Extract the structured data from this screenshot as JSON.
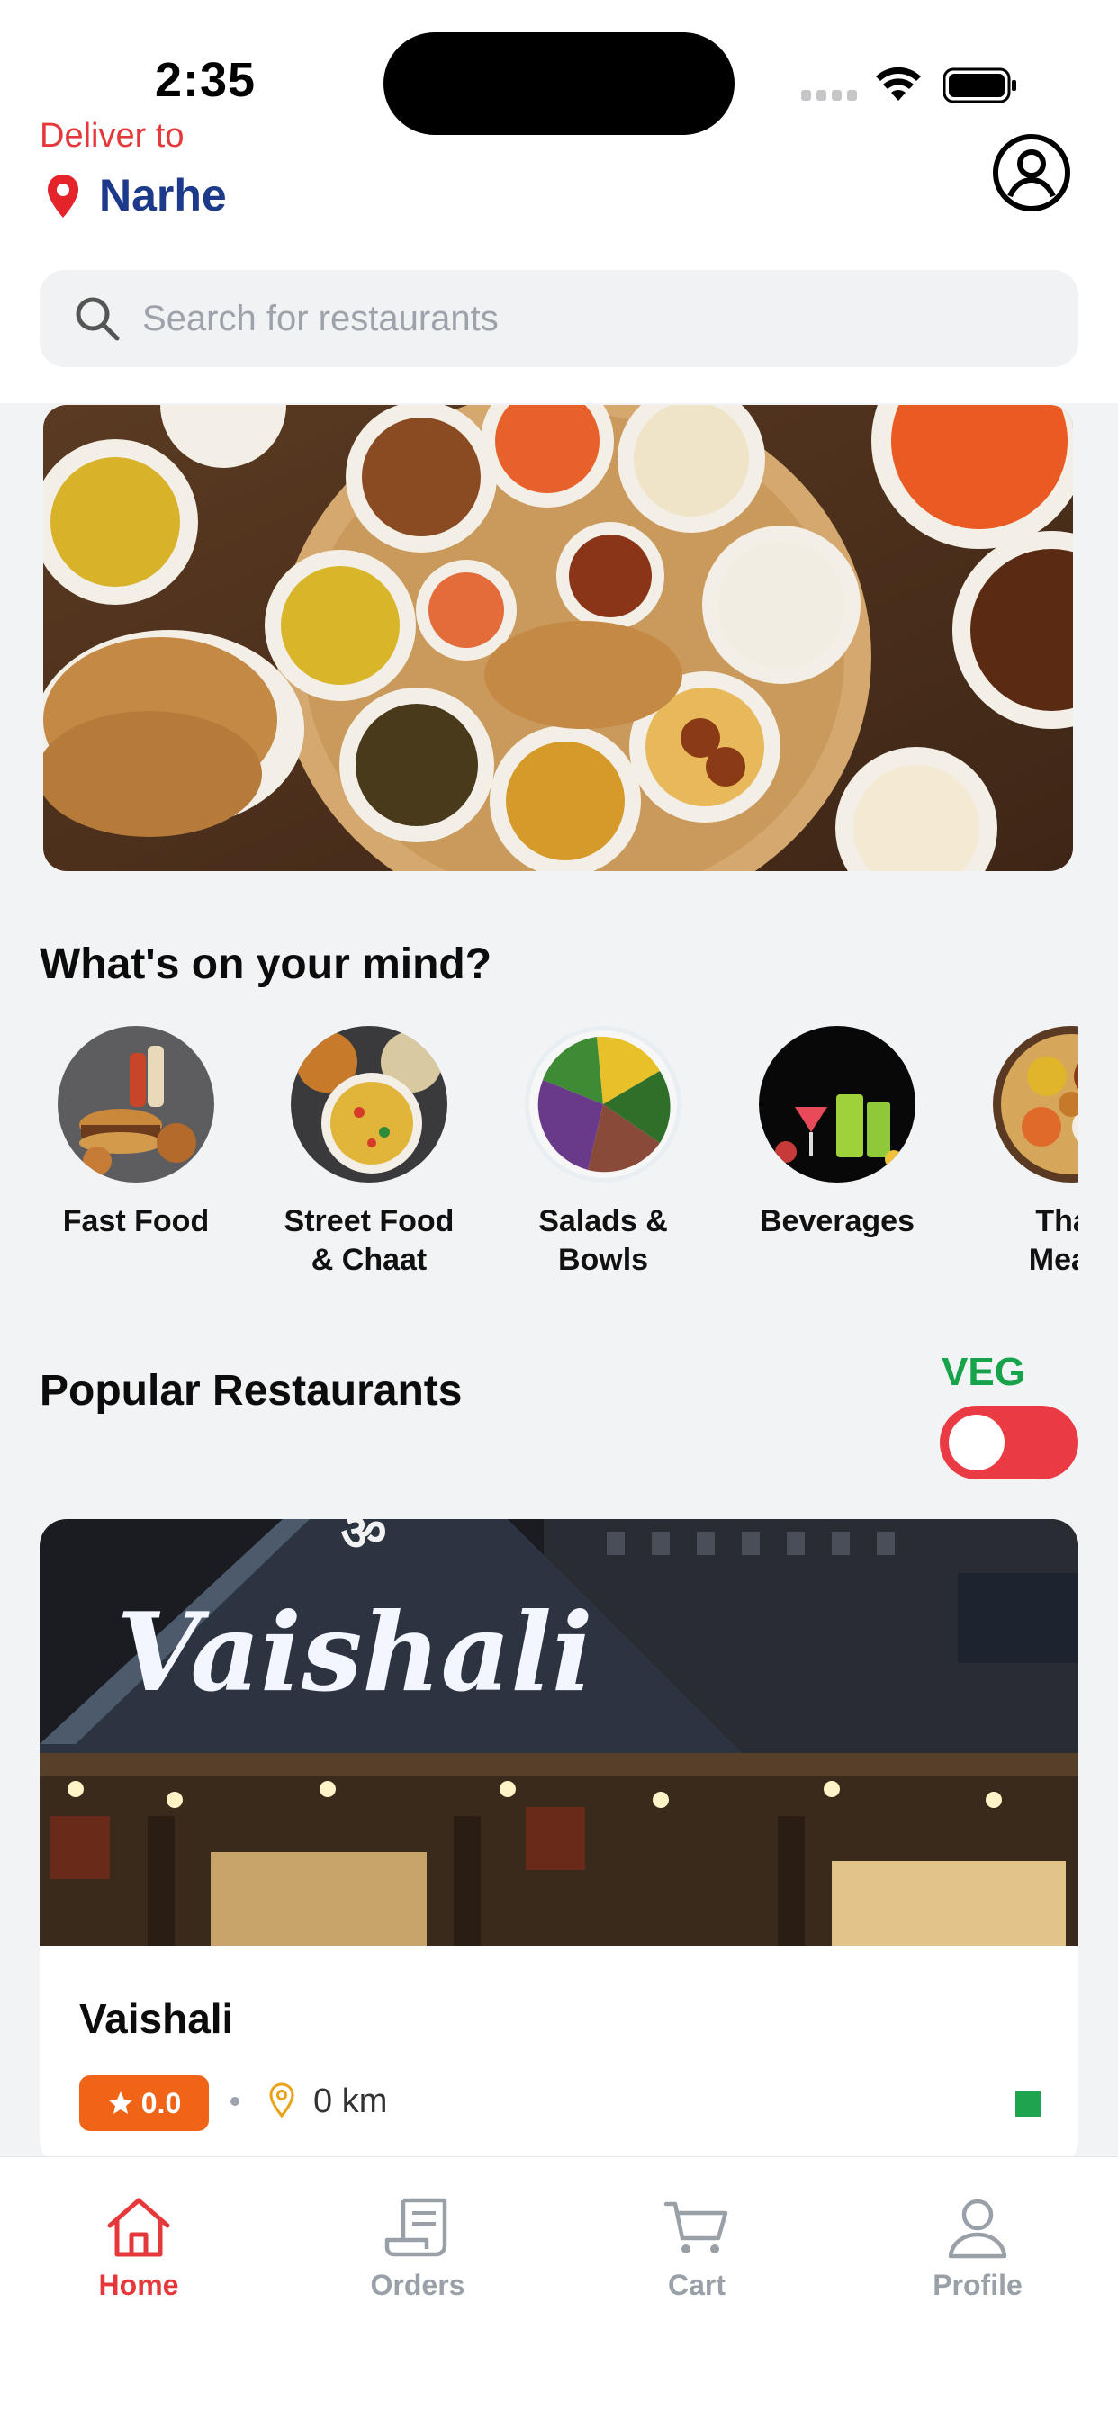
{
  "status": {
    "time": "2:35"
  },
  "header": {
    "deliver_label": "Deliver to",
    "location": "Narhe",
    "pin_icon": "location-pin-icon",
    "account_icon": "account-circle-icon"
  },
  "search": {
    "placeholder": "Search for restaurants",
    "value": ""
  },
  "sections": {
    "mind_title": "What's on your mind?",
    "popular_title": "Popular Restaurants"
  },
  "categories": [
    {
      "label": "Fast Food"
    },
    {
      "label": "Street Food\n& Chaat"
    },
    {
      "label": "Salads &\nBowls"
    },
    {
      "label": "Beverages"
    },
    {
      "label": "Thali\nMeals"
    }
  ],
  "veg_filter": {
    "label": "VEG",
    "enabled": false
  },
  "restaurant": {
    "name": "Vaishali",
    "photo_sign": "Vaishali",
    "rating": "0.0",
    "distance": "0 km",
    "veg": true
  },
  "nav": {
    "items": [
      {
        "label": "Home",
        "icon": "home-icon",
        "active": true
      },
      {
        "label": "Orders",
        "icon": "receipt-icon",
        "active": false
      },
      {
        "label": "Cart",
        "icon": "cart-icon",
        "active": false
      },
      {
        "label": "Profile",
        "icon": "person-icon",
        "active": false
      }
    ]
  },
  "colors": {
    "accent_red": "#e5383b",
    "location_blue": "#1d3a8a",
    "veg_green": "#17a34a",
    "rating_orange": "#f06418"
  }
}
